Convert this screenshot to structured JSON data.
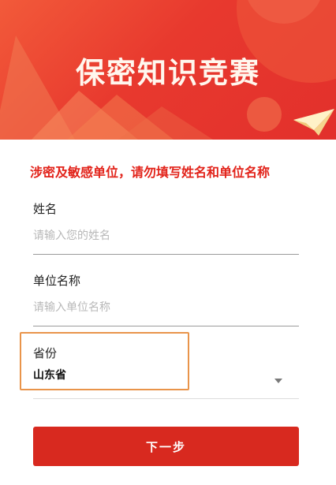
{
  "header": {
    "title": "保密知识竞赛"
  },
  "notice": "涉密及敏感单位，请勿填写姓名和单位名称",
  "form": {
    "name": {
      "label": "姓名",
      "placeholder": "请输入您的姓名",
      "value": ""
    },
    "unit": {
      "label": "单位名称",
      "placeholder": "请输入单位名称",
      "value": ""
    },
    "province": {
      "label": "省份",
      "value": "山东省"
    }
  },
  "next_button": {
    "label": "下一步"
  },
  "colors": {
    "brand_red": "#e2302c",
    "highlight_border": "#e9944a"
  }
}
